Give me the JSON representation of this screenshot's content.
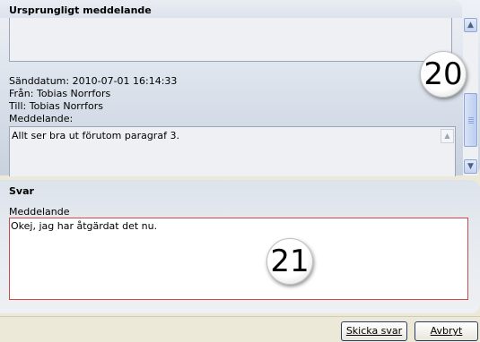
{
  "original": {
    "title": "Ursprungligt meddelande",
    "sent_date": "Sänddatum: 2010-07-01 16:14:33",
    "from": "Från: Tobias Norrfors",
    "to": "Till: Tobias Norrfors",
    "message_label": "Meddelande:",
    "message_text": "Allt ser bra ut förutom paragraf 3."
  },
  "callouts": {
    "upper": "20",
    "lower": "21"
  },
  "reply": {
    "title": "Svar",
    "message_label": "Meddelande",
    "message_value": "Okej, jag har åtgärdat det nu."
  },
  "buttons": {
    "send": "Skicka svar",
    "cancel": "Avbryt"
  },
  "icons": {
    "scroll_up": "scroll-up-arrow-icon",
    "scroll_down": "scroll-down-arrow-icon"
  }
}
